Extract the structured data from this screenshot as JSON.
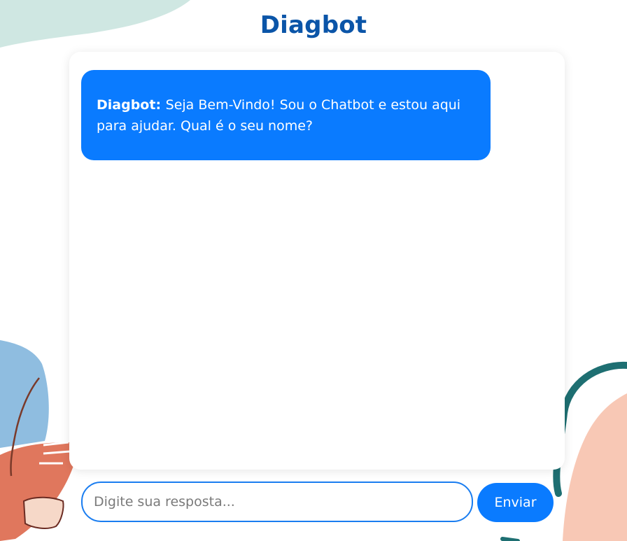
{
  "app": {
    "title": "Diagbot"
  },
  "chat": {
    "messages": [
      {
        "sender": "Diagbot:",
        "text": "Seja Bem-Vindo! Sou o Chatbot e estou aqui para ajudar. Qual é o seu nome?"
      }
    ]
  },
  "composer": {
    "value": "",
    "placeholder": "Digite sua resposta...",
    "send_label": "Enviar"
  },
  "colors": {
    "title": "#0b55a8",
    "accent": "#0a7bff",
    "input_border": "#1a7df0",
    "decor_mint": "#cfe7e2",
    "decor_blue": "#8fbde0",
    "decor_orange": "#e0775d",
    "decor_peach": "#f8c8b5",
    "decor_teal": "#1e6f72"
  }
}
